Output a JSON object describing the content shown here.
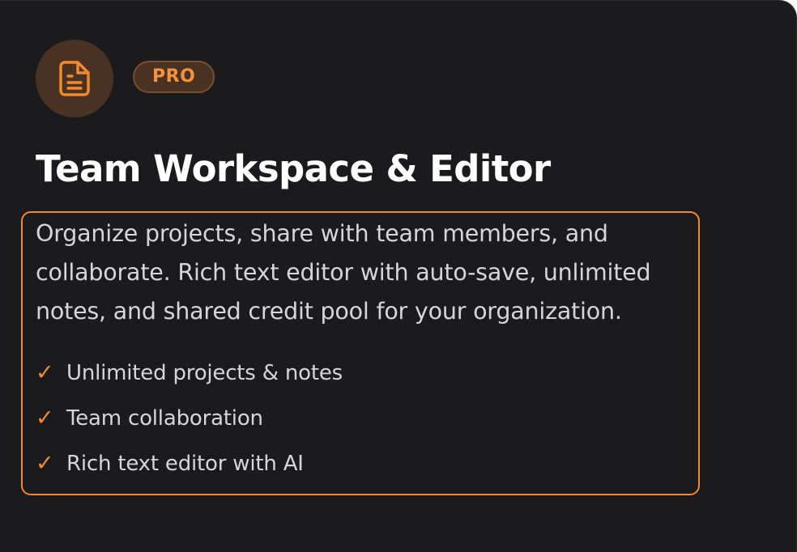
{
  "card": {
    "icon": "document-icon",
    "badge": "PRO",
    "title": "Team Workspace & Editor",
    "description": "Organize projects, share with team members, and collaborate. Rich text editor with auto-save, unlimited notes, and shared credit pool for your organization.",
    "features": [
      {
        "check": "✓",
        "label": "Unlimited projects & notes"
      },
      {
        "check": "✓",
        "label": "Team collaboration"
      },
      {
        "check": "✓",
        "label": "Rich text editor with AI"
      }
    ]
  },
  "colors": {
    "background": "#1b1b1d",
    "accent": "#f5892e",
    "accent_dark": "#4a3222",
    "title": "#ffffff",
    "body_text": "#d6d6da"
  }
}
